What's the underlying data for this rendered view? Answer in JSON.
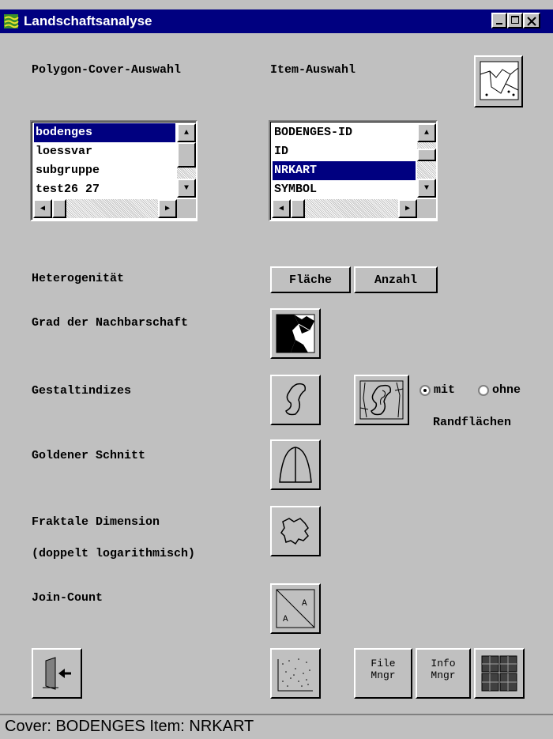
{
  "window": {
    "title": "Landschaftsanalyse"
  },
  "titlebar_buttons": {
    "minimize": "_",
    "maximize": "□",
    "close": "✕"
  },
  "labels": {
    "polygon_cover": "Polygon-Cover-Auswahl",
    "item_auswahl": "Item-Auswahl",
    "heterogenitaet": "Heterogenität",
    "nachbarschaft": "Grad der Nachbarschaft",
    "gestaltindizes": "Gestaltindizes",
    "goldener_schnitt": "Goldener Schnitt",
    "fraktale_1": "Fraktale Dimension",
    "fraktale_2": "(doppelt logarithmisch)",
    "join_count": "Join-Count",
    "randflaechen": "Randflächen"
  },
  "cover_list": {
    "items": [
      "bodenges",
      "loessvar",
      "subgruppe",
      "test26 27"
    ],
    "selected": "bodenges"
  },
  "item_list": {
    "items": [
      "BODENGES-ID",
      "ID",
      "NRKART",
      "SYMBOL"
    ],
    "selected": "NRKART"
  },
  "buttons": {
    "flaeche": "Fläche",
    "anzahl": "Anzahl"
  },
  "radios": {
    "mit": "mit",
    "ohne": "ohne",
    "selected": "mit"
  },
  "toolbar": {
    "file_mngr_1": "File",
    "file_mngr_2": "Mngr",
    "info_mngr_1": "Info",
    "info_mngr_2": "Mngr"
  },
  "status": {
    "text": "Cover: BODENGES  Item: NRKART"
  }
}
